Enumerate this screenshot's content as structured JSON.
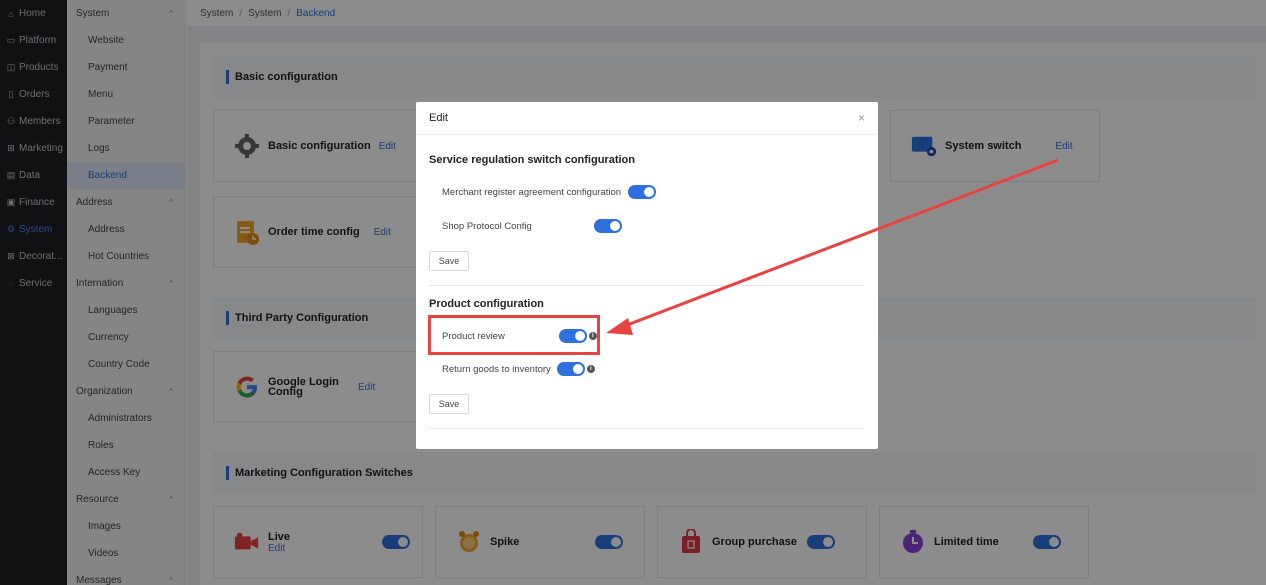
{
  "nav_primary": [
    {
      "label": "Home",
      "icon": "home-icon"
    },
    {
      "label": "Platform",
      "icon": "monitor-icon"
    },
    {
      "label": "Products",
      "icon": "bag-icon"
    },
    {
      "label": "Orders",
      "icon": "document-icon"
    },
    {
      "label": "Members",
      "icon": "users-icon"
    },
    {
      "label": "Marketing",
      "icon": "gift-icon"
    },
    {
      "label": "Data",
      "icon": "chart-icon"
    },
    {
      "label": "Finance",
      "icon": "ledger-icon"
    },
    {
      "label": "System",
      "icon": "gear-icon",
      "active": true
    },
    {
      "label": "Decorat...",
      "icon": "palette-icon"
    },
    {
      "label": "Service",
      "icon": "chat-icon"
    }
  ],
  "nav_secondary": {
    "system": {
      "label": "System",
      "items": [
        "Website",
        "Payment",
        "Menu",
        "Parameter",
        "Logs",
        "Backend"
      ]
    },
    "address": {
      "label": "Address",
      "items": [
        "Address",
        "Hot Countries"
      ]
    },
    "internation": {
      "label": "Internation",
      "items": [
        "Languages",
        "Currency",
        "Country Code"
      ]
    },
    "organization": {
      "label": "Organization",
      "items": [
        "Administrators",
        "Roles",
        "Access Key"
      ]
    },
    "resource": {
      "label": "Resource",
      "items": [
        "Images",
        "Videos"
      ]
    },
    "messages": {
      "label": "Messages"
    }
  },
  "breadcrumb": [
    "System",
    "System",
    "Backend"
  ],
  "sections": {
    "basic": "Basic configuration",
    "third_party": "Third Party Configuration",
    "marketing": "Marketing Configuration Switches"
  },
  "cards": {
    "basic_config": {
      "title": "Basic configuration",
      "edit": "Edit"
    },
    "system_switch": {
      "title": "System switch",
      "edit": "Edit"
    },
    "order_time": {
      "title": "Order time config",
      "edit": "Edit"
    },
    "google_login": {
      "title": "Google Login Config",
      "edit": "Edit"
    },
    "live": {
      "title": "Live",
      "edit": "Edit"
    },
    "spike": {
      "title": "Spike"
    },
    "group_purchase": {
      "title": "Group purchase"
    },
    "limited_time": {
      "title": "Limited time"
    }
  },
  "modal": {
    "title": "Edit",
    "close_icon": "×",
    "service_section": {
      "title": "Service regulation switch configuration",
      "rows": [
        {
          "label": "Merchant register agreement configuration",
          "on": true
        },
        {
          "label": "Shop Protocol Config",
          "on": true
        }
      ],
      "save": "Save"
    },
    "product_section": {
      "title": "Product configuration",
      "rows": [
        {
          "label": "Product review",
          "on": true
        },
        {
          "label": "Return goods to inventory",
          "on": true
        }
      ],
      "save": "Save"
    }
  },
  "colors": {
    "accent": "#2f6fde",
    "annotation": "#e8433f"
  }
}
